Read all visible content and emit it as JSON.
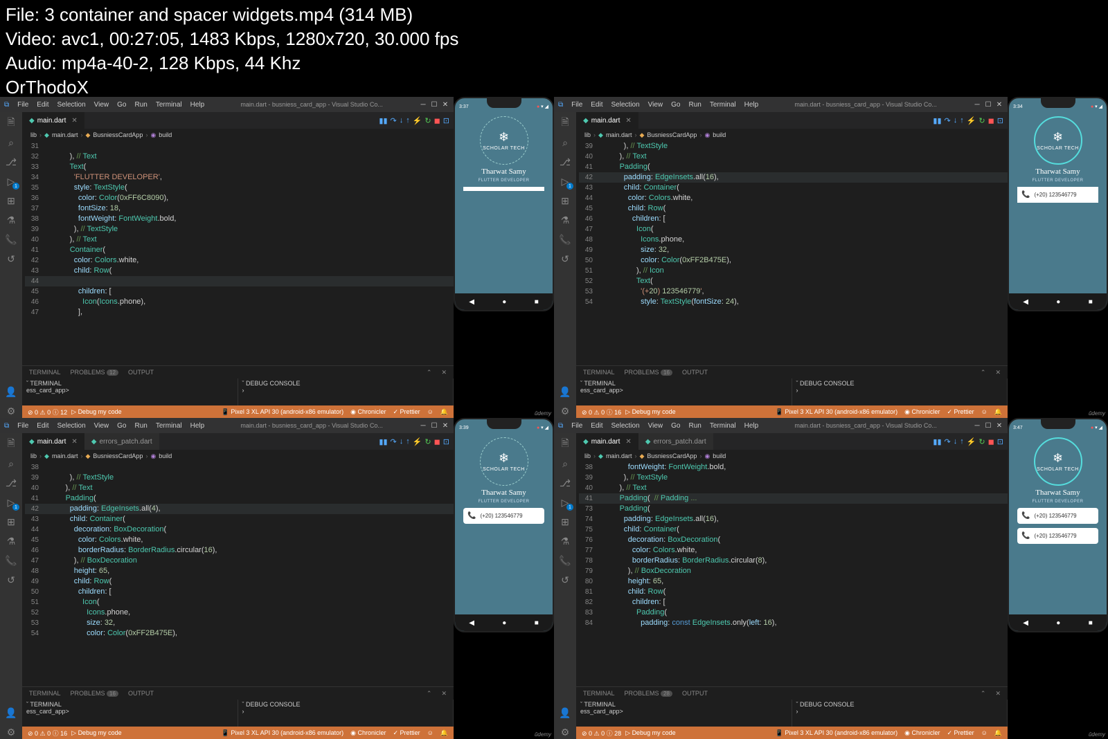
{
  "header": {
    "file": "File: 3  container and spacer widgets.mp4 (314 MB)",
    "video": "Video: avc1, 00:27:05, 1483 Kbps, 1280x720, 30.000 fps",
    "audio": "Audio: mp4a-40-2, 128 Kbps, 44 Khz",
    "sig": "OrThodoX"
  },
  "menu": [
    "File",
    "Edit",
    "Selection",
    "View",
    "Go",
    "Run",
    "Terminal",
    "Help"
  ],
  "wintitle": "main.dart - busniess_card_app - Visual Studio Co...",
  "tab_main": "main.dart",
  "tab_err": "errors_patch.dart",
  "crumb": {
    "lib": "lib",
    "main": "main.dart",
    "cls": "BusniessCardApp",
    "m": "build"
  },
  "panel": {
    "terminal": "TERMINAL",
    "problems": "PROBLEMS",
    "output": "OUTPUT",
    "term_hd": "TERMINAL",
    "dbg_hd": "DEBUG CONSOLE",
    "prompt": "ess_card_app>"
  },
  "status": {
    "debug": "Debug my code",
    "device": "Pixel 3 XL API 30 (android-x86 emulator)",
    "chron": "Chronicler",
    "pret": "Prettier"
  },
  "phone": {
    "brand": "SCHOLAR TECH",
    "name": "Tharwat Samy",
    "sub": "FLUTTER DEVELOPER",
    "num": "(+20) 123546779"
  },
  "panes": {
    "p1": {
      "problems": "12",
      "errs": "0",
      "warn": "0",
      "info": "12",
      "time": "3:37",
      "code_start": 31
    },
    "p2": {
      "problems": "16",
      "errs": "0",
      "warn": "0",
      "info": "16",
      "time": "3:34",
      "code_start": 39
    },
    "p3": {
      "problems": "16",
      "errs": "0",
      "warn": "0",
      "info": "16",
      "time": "3:39",
      "code_start": 38
    },
    "p4": {
      "problems": "28",
      "errs": "0",
      "warn": "0",
      "info": "28",
      "time": "3:47",
      "code_start": 38
    }
  },
  "code1": [
    [
      "31",
      ""
    ],
    [
      "32",
      "            ), // Text"
    ],
    [
      "33",
      "            Text("
    ],
    [
      "34",
      "              'FLUTTER DEVELOPER',"
    ],
    [
      "35",
      "              style: TextStyle("
    ],
    [
      "36",
      "                color: Color(0xFF6C8090),"
    ],
    [
      "37",
      "                fontSize: 18,"
    ],
    [
      "38",
      "                fontWeight: FontWeight.bold,"
    ],
    [
      "39",
      "              ), // TextStyle"
    ],
    [
      "40",
      "            ), // Text"
    ],
    [
      "41",
      "            Container("
    ],
    [
      "42",
      "              color: Colors.white,"
    ],
    [
      "43",
      "              child: Row("
    ],
    [
      "44",
      ""
    ],
    [
      "45",
      "                children: ["
    ],
    [
      "46",
      "                  Icon(Icons.phone),"
    ],
    [
      "47",
      "                ],"
    ]
  ],
  "code2": [
    [
      "39",
      "            ), // TextStyle"
    ],
    [
      "40",
      "          ), // Text"
    ],
    [
      "41",
      "          Padding("
    ],
    [
      "42",
      "            padding: EdgeInsets.all(16),"
    ],
    [
      "43",
      "            child: Container("
    ],
    [
      "44",
      "              color: Colors.white,"
    ],
    [
      "45",
      "              child: Row("
    ],
    [
      "46",
      "                children: ["
    ],
    [
      "47",
      "                  Icon("
    ],
    [
      "48",
      "                    Icons.phone,"
    ],
    [
      "49",
      "                    size: 32,"
    ],
    [
      "50",
      "                    color: Color(0xFF2B475E),"
    ],
    [
      "51",
      "                  ), // Icon"
    ],
    [
      "52",
      "                  Text("
    ],
    [
      "53",
      "                    '(+20) 123546779',"
    ],
    [
      "54",
      "                    style: TextStyle(fontSize: 24),"
    ]
  ],
  "code3": [
    [
      "38",
      ""
    ],
    [
      "39",
      "            ), // TextStyle"
    ],
    [
      "40",
      "          ), // Text"
    ],
    [
      "41",
      "          Padding("
    ],
    [
      "42",
      "            padding: EdgeInsets.all(4),"
    ],
    [
      "43",
      "            child: Container("
    ],
    [
      "44",
      "              decoration: BoxDecoration("
    ],
    [
      "45",
      "                color: Colors.white,"
    ],
    [
      "46",
      "                borderRadius: BorderRadius.circular(16),"
    ],
    [
      "47",
      "              ), // BoxDecoration"
    ],
    [
      "48",
      "              height: 65,"
    ],
    [
      "49",
      "              child: Row("
    ],
    [
      "50",
      "                children: ["
    ],
    [
      "51",
      "                  Icon("
    ],
    [
      "52",
      "                    Icons.phone,"
    ],
    [
      "53",
      "                    size: 32,"
    ],
    [
      "54",
      "                    color: Color(0xFF2B475E),"
    ]
  ],
  "code4": [
    [
      "38",
      "              fontWeight: FontWeight.bold,"
    ],
    [
      "39",
      "            ), // TextStyle"
    ],
    [
      "40",
      "          ), // Text"
    ],
    [
      "41",
      "          Padding(  // Padding ..."
    ],
    [
      "73",
      "          Padding("
    ],
    [
      "74",
      "            padding: EdgeInsets.all(16),"
    ],
    [
      "75",
      "            child: Container("
    ],
    [
      "76",
      "              decoration: BoxDecoration("
    ],
    [
      "77",
      "                color: Colors.white,"
    ],
    [
      "78",
      "                borderRadius: BorderRadius.circular(8),"
    ],
    [
      "79",
      "              ), // BoxDecoration"
    ],
    [
      "80",
      "              height: 65,"
    ],
    [
      "81",
      "              child: Row("
    ],
    [
      "82",
      "                children: ["
    ],
    [
      "83",
      "                  Padding("
    ],
    [
      "84",
      "                    padding: const EdgeInsets.only(left: 16),"
    ]
  ]
}
